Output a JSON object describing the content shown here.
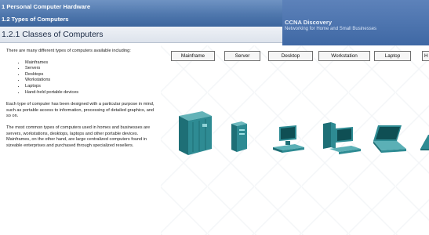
{
  "header": {
    "chapter": "1 Personal Computer Hardware",
    "section": "1.2 Types of Computers",
    "brand_title": "CCNA Discovery",
    "brand_subtitle": "Networking for Home and Small Businesses"
  },
  "page_title": "1.2.1 Classes of Computers",
  "content": {
    "intro": "There are many different types of computers available including:",
    "list": [
      "Mainframes",
      "Servers",
      "Desktops",
      "Workstations",
      "Laptops",
      "Hand-held portable devices"
    ],
    "para2": "Each type of computer has been designed with a particular purpose in mind, such as portable access to information, processing of detailed graphics, and so on.",
    "para3": "The most common types of computers used in homes and businesses are servers, workstations, desktops, laptops and other portable devices. Mainframes, on the other hand, are large centralized computers found in sizeable enterprises and purchased through specialized resellers."
  },
  "diagram": {
    "tabs": [
      "Mainframe",
      "Server",
      "Desktop",
      "Workstation",
      "Laptop",
      "H"
    ],
    "device_color": "#2e8b93",
    "icons": [
      "mainframe-icon",
      "server-icon",
      "desktop-icon",
      "workstation-icon",
      "laptop-icon",
      "handheld-icon"
    ]
  }
}
